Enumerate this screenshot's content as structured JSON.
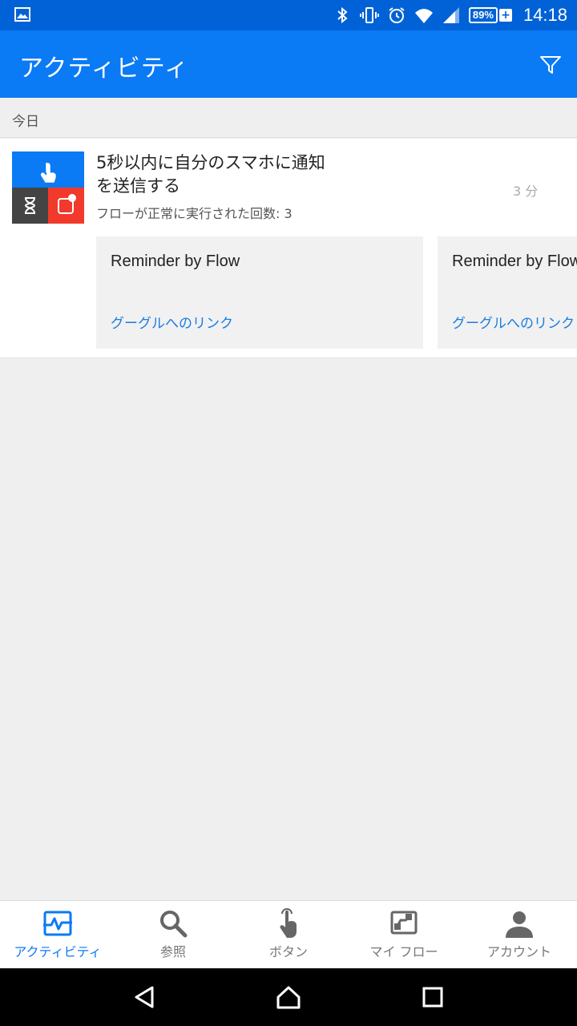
{
  "status_bar": {
    "left_icon": "image-notification-icon",
    "icons": [
      "bluetooth-icon",
      "vibrate-icon",
      "alarm-icon",
      "wifi-icon",
      "signal-icon"
    ],
    "battery": "89%",
    "battery_charging": "+",
    "time": "14:18"
  },
  "app_bar": {
    "title": "アクティビティ",
    "filter_icon": "filter-icon"
  },
  "section": {
    "label": "今日"
  },
  "activity": {
    "title": "5秒以内に自分のスマホに通知を送信する",
    "subtitle": "フローが正常に実行された回数: 3",
    "time": "3 分",
    "icon_colors": {
      "top": "#0a7af5",
      "bottom_left": "#444444",
      "bottom_right": "#f13a2c"
    },
    "cards": [
      {
        "title": "Reminder by Flow",
        "link": "グーグルへのリンク"
      },
      {
        "title": "Reminder by Flow",
        "link": "グーグルへのリンク"
      }
    ]
  },
  "bottom_nav": {
    "items": [
      {
        "label": "アクティビティ",
        "icon": "activity-icon",
        "active": true
      },
      {
        "label": "参照",
        "icon": "search-icon",
        "active": false
      },
      {
        "label": "ボタン",
        "icon": "touch-button-icon",
        "active": false
      },
      {
        "label": "マイ フロー",
        "icon": "my-flows-icon",
        "active": false
      },
      {
        "label": "アカウント",
        "icon": "account-icon",
        "active": false
      }
    ]
  },
  "colors": {
    "status_bar": "#0062d6",
    "app_bar": "#0a7af5",
    "accent": "#0a7af5",
    "link": "#1a7de0"
  }
}
